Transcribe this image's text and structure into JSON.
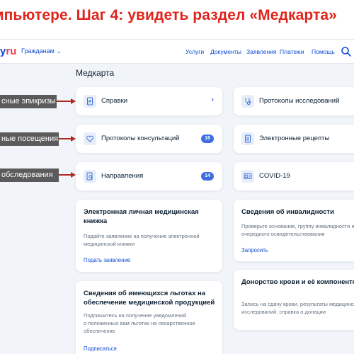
{
  "slide": {
    "title": "мпьютере. Шаг 4: увидеть раздел «Медкарта»"
  },
  "header": {
    "logo_left": "у",
    "logo_right": "ru",
    "audience": "Гражданам",
    "nav": [
      "Услуги",
      "Документы",
      "Заявления",
      "Платежи",
      "Помощь"
    ]
  },
  "page": {
    "title": "Медкарта"
  },
  "tiles_left": [
    {
      "label": "Справки",
      "icon": "document-icon"
    },
    {
      "label": "Протоколы консультаций",
      "badge": "16",
      "icon": "heart-icon"
    },
    {
      "label": "Направления",
      "badge": "14",
      "icon": "search-document-icon"
    }
  ],
  "tiles_right": [
    {
      "label": "Протоколы исследований",
      "icon": "stethoscope-icon"
    },
    {
      "label": "Электронные рецепты",
      "icon": "prescription-icon"
    },
    {
      "label": "COVID-19",
      "icon": "id-card-icon"
    }
  ],
  "cards": {
    "medbook": {
      "title_line1": "Электронная личная медицинская",
      "title_line2": "книжка",
      "desc_line1": "Подайте заявление на получение электронной",
      "desc_line2": "медицинской книжки",
      "link": "Подать заявление"
    },
    "disability": {
      "title": "Сведения об инвалидности",
      "desc_line1": "Проверьте основание, группу инвалидности и",
      "desc_line2": "очередного освидетельствования",
      "link": "Запросить"
    },
    "benefits": {
      "title_line1": "Сведения об имеющихся льготах на",
      "title_line2": "обеспечение медицинской продукцией",
      "desc_line1": "Подпишитесь на получение уведомлений",
      "desc_line2": "о положенных вам льготах на лекарственное",
      "desc_line3": "обеспечение",
      "link": "Подписаться"
    },
    "donation": {
      "title": "Донорство крови и её компонентов",
      "desc_line1": "Запись на сдачу крови, результаты медицинск",
      "desc_line2": "исследований, справка о донации"
    }
  },
  "callouts": [
    "сные эпикризы",
    "ные посещения",
    "обследования"
  ]
}
